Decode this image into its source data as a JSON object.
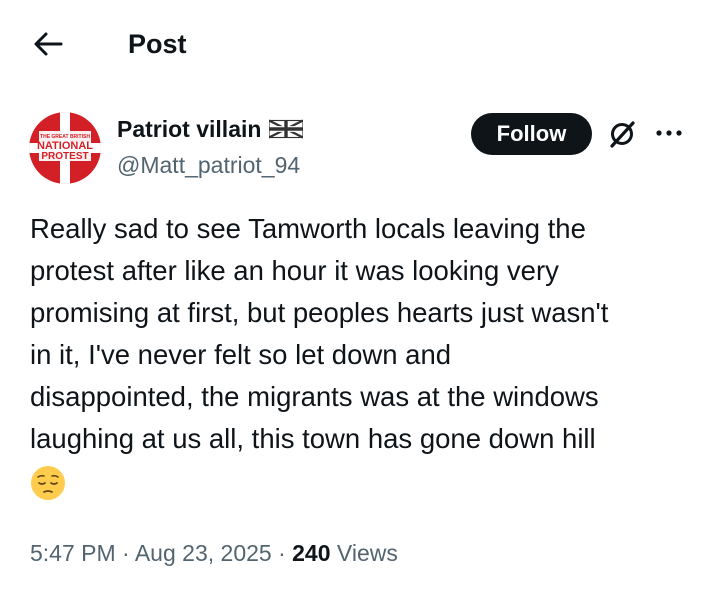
{
  "header": {
    "title": "Post",
    "back_icon": "arrow-left-icon"
  },
  "author": {
    "name": "Patriot villain",
    "handle": "@Matt_patriot_94",
    "flag_icon": "uk-flag-icon",
    "avatar_text": [
      "THE GREAT BRITISH",
      "NATIONAL",
      "PROTEST"
    ]
  },
  "actions": {
    "follow_label": "Follow",
    "grok_icon": "grok-icon",
    "more_icon": "more-options-icon"
  },
  "tweet": {
    "lines": [
      "Really sad to see Tamworth locals leaving the",
      "protest after like an hour it was looking very",
      "promising at first, but peoples hearts just wasn't",
      "in it, I've never felt so let down and",
      "disappointed, the migrants was at the windows",
      "laughing at us all, this town has gone down hill"
    ],
    "emoji": "pensive-face-emoji"
  },
  "meta": {
    "time": "5:47 PM",
    "separator": "·",
    "date": "Aug 23, 2025",
    "views_count": "240",
    "views_label": "Views"
  },
  "colors": {
    "text": "#0f1419",
    "secondary": "#536471",
    "follow_bg": "#0f1419",
    "avatar_red": "#d32027"
  }
}
